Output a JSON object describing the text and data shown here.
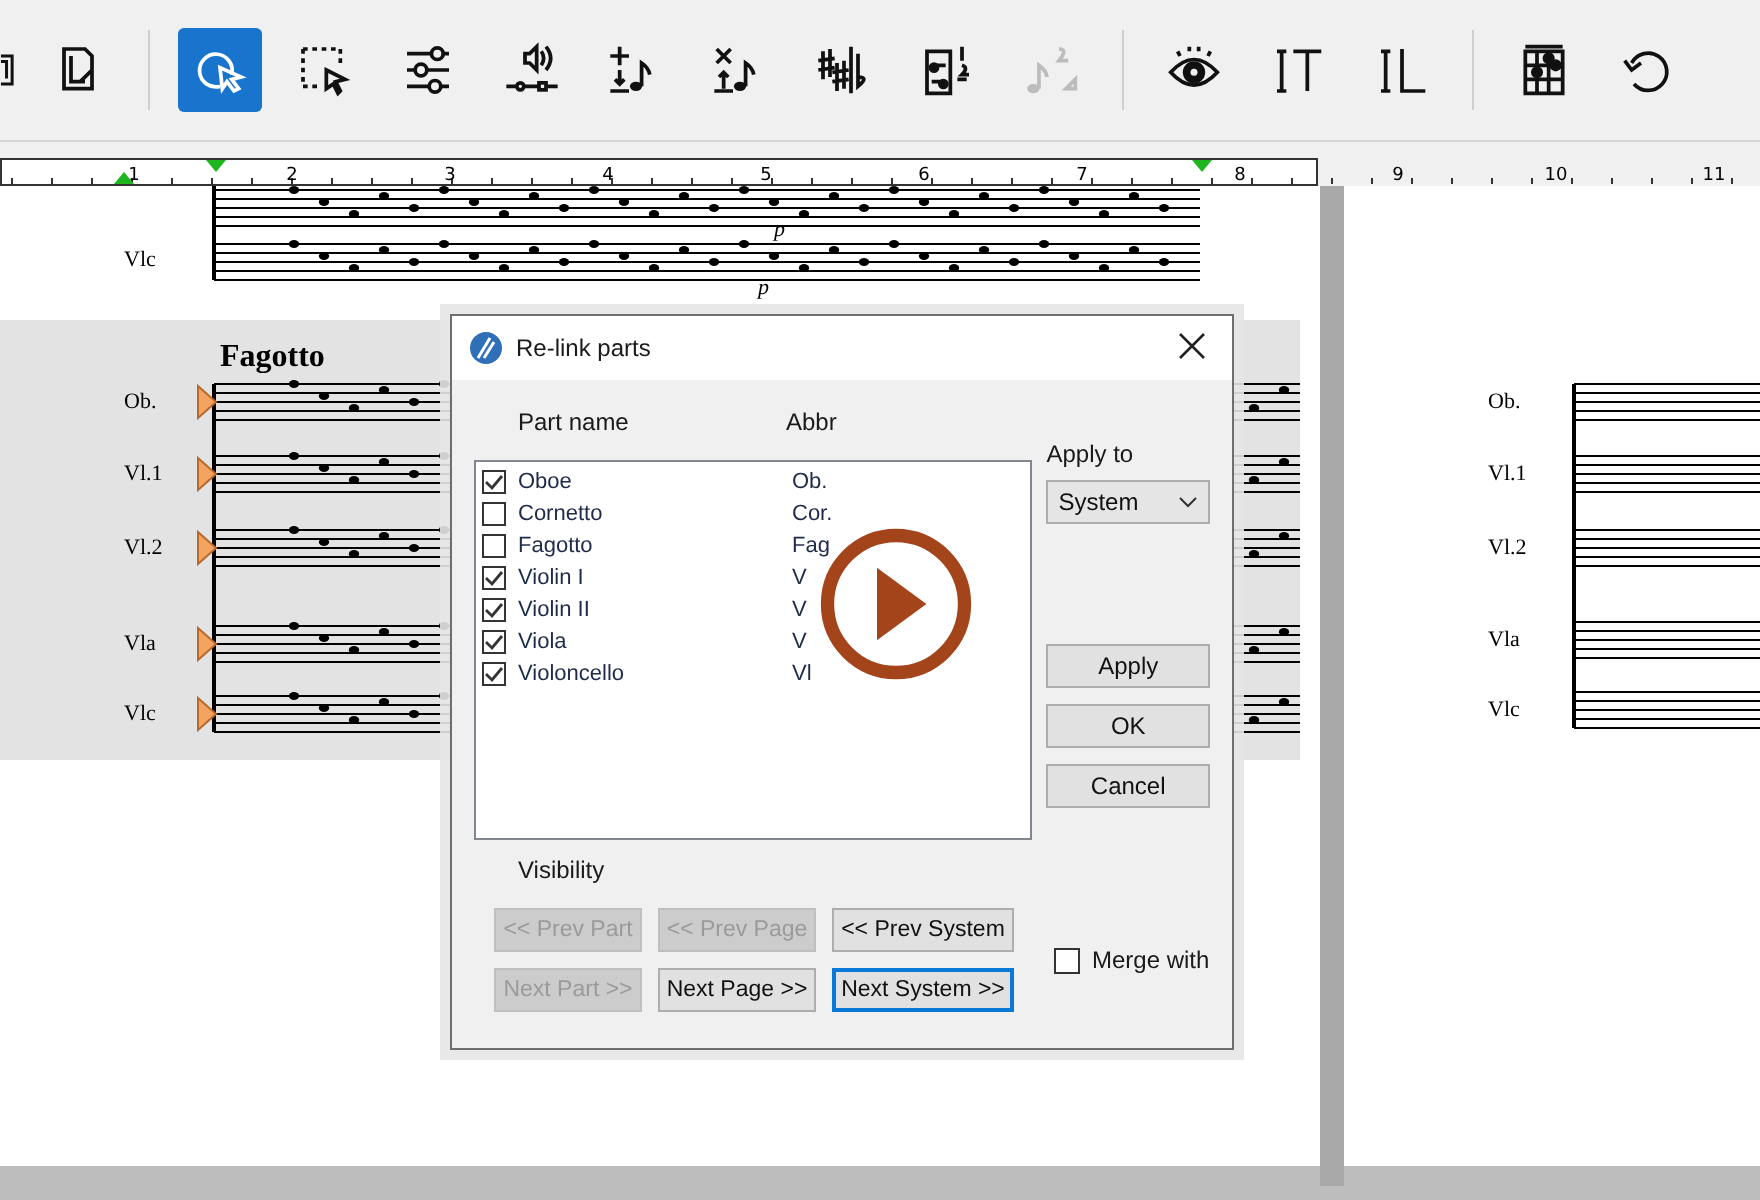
{
  "toolbar": {
    "groups": [
      {
        "tools": [
          {
            "kind": "page-edge",
            "selected": false,
            "disabled": false
          },
          {
            "kind": "document-edit",
            "selected": false,
            "disabled": false
          }
        ]
      },
      {
        "tools": [
          {
            "kind": "select",
            "selected": true,
            "disabled": false
          },
          {
            "kind": "marquee",
            "selected": false,
            "disabled": false
          },
          {
            "kind": "sliders",
            "selected": false,
            "disabled": false
          },
          {
            "kind": "speaker",
            "selected": false,
            "disabled": false
          },
          {
            "kind": "add-note",
            "selected": false,
            "disabled": false
          },
          {
            "kind": "delete-note",
            "selected": false,
            "disabled": false
          },
          {
            "kind": "accidentals",
            "selected": false,
            "disabled": false
          },
          {
            "kind": "voices",
            "selected": false,
            "disabled": false
          },
          {
            "kind": "note",
            "selected": false,
            "disabled": true
          }
        ]
      },
      {
        "tools": [
          {
            "kind": "eye",
            "selected": false,
            "disabled": false
          },
          {
            "kind": "text-t",
            "selected": false,
            "disabled": false
          },
          {
            "kind": "text-l",
            "selected": false,
            "disabled": false
          }
        ]
      },
      {
        "tools": [
          {
            "kind": "chord-grid",
            "selected": false,
            "disabled": false
          },
          {
            "kind": "undo",
            "selected": false,
            "disabled": false
          }
        ]
      }
    ]
  },
  "ruler": {
    "numbers": [
      "1",
      "2",
      "3",
      "4",
      "5",
      "6",
      "7",
      "8",
      "9",
      "10",
      "11"
    ]
  },
  "left_page": {
    "upper_system": {
      "labels": [
        "Vlc"
      ],
      "dynamics": [
        "p",
        "p"
      ]
    },
    "highlighted_system": {
      "title": "Fagotto",
      "labels": [
        "Ob.",
        "Vl.1",
        "Vl.2",
        "Vla",
        "Vlc"
      ]
    }
  },
  "right_page": {
    "labels": [
      "Ob.",
      "Vl.1",
      "Vl.2",
      "Vla",
      "Vlc"
    ]
  },
  "dialog": {
    "title": "Re-link parts",
    "columns": [
      "Part name",
      "Abbr"
    ],
    "parts": [
      {
        "name": "Oboe",
        "abbr": "Ob.",
        "checked": true
      },
      {
        "name": "Cornetto",
        "abbr": "Cor.",
        "checked": false
      },
      {
        "name": "Fagotto",
        "abbr": "Fag",
        "checked": false
      },
      {
        "name": "Violin I",
        "abbr": "V",
        "checked": true
      },
      {
        "name": "Violin II",
        "abbr": "V",
        "checked": true
      },
      {
        "name": "Viola",
        "abbr": "V",
        "checked": true
      },
      {
        "name": "Violoncello",
        "abbr": "Vl",
        "checked": true
      }
    ],
    "apply_to": {
      "label": "Apply to",
      "value": "System"
    },
    "buttons": [
      "Apply",
      "OK",
      "Cancel"
    ],
    "visibility_label": "Visibility",
    "nav_buttons": [
      {
        "label": "<< Prev Part",
        "disabled": true,
        "focused": false
      },
      {
        "label": "<< Prev Page",
        "disabled": true,
        "focused": false
      },
      {
        "label": "<< Prev System",
        "disabled": false,
        "focused": false
      },
      {
        "label": "Next Part >>",
        "disabled": true,
        "focused": false
      },
      {
        "label": "Next Page >>",
        "disabled": false,
        "focused": false
      },
      {
        "label": "Next System >>",
        "disabled": false,
        "focused": true
      }
    ],
    "merge": {
      "label": "Merge with",
      "checked": false
    }
  }
}
